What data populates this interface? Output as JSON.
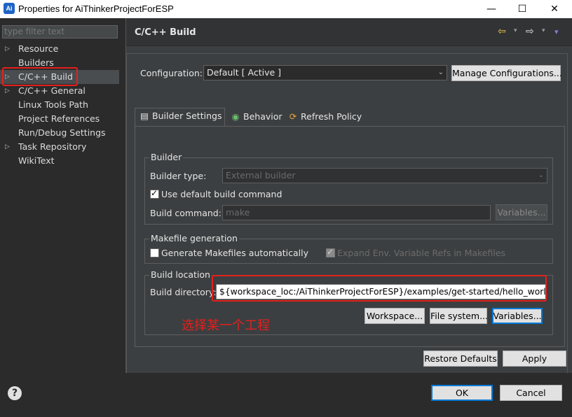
{
  "window": {
    "title": "Properties for AiThinkerProjectForESP",
    "app_icon": "Ai",
    "minimize_glyph": "—",
    "maximize_glyph": "☐",
    "close_glyph": "✕"
  },
  "sidebar": {
    "filter_placeholder": "type filter text",
    "items": [
      {
        "label": "Resource",
        "expandable": true
      },
      {
        "label": "Builders",
        "expandable": false
      },
      {
        "label": "C/C++ Build",
        "expandable": true,
        "selected": true
      },
      {
        "label": "C/C++ General",
        "expandable": true
      },
      {
        "label": "Linux Tools Path",
        "expandable": false
      },
      {
        "label": "Project References",
        "expandable": false
      },
      {
        "label": "Run/Debug Settings",
        "expandable": false
      },
      {
        "label": "Task Repository",
        "expandable": true
      },
      {
        "label": "WikiText",
        "expandable": false
      }
    ],
    "arrow_glyph": "▷"
  },
  "header": {
    "title": "C/C++ Build",
    "back_icon": "⇦",
    "forward_icon": "⇨",
    "menu_caret": "▾"
  },
  "configuration": {
    "label": "Configuration:",
    "value": "Default  [ Active ]",
    "manage_button": "Manage Configurations..."
  },
  "tabs": [
    {
      "label": "Builder Settings",
      "icon": "▤",
      "active": true
    },
    {
      "label": "Behavior",
      "icon": "◉",
      "active": false
    },
    {
      "label": "Refresh Policy",
      "icon": "⟳",
      "active": false
    }
  ],
  "builder_group": {
    "title": "Builder",
    "type_label": "Builder type:",
    "type_value": "External builder",
    "use_default_label": "Use default build command",
    "use_default_checked": true,
    "command_label": "Build command:",
    "command_value": "make",
    "variables_button": "Variables..."
  },
  "makefile_group": {
    "title": "Makefile generation",
    "generate_label": "Generate Makefiles automatically",
    "generate_checked": false,
    "expand_label": "Expand Env. Variable Refs in Makefiles",
    "expand_checked": true
  },
  "location_group": {
    "title": "Build location",
    "dir_label": "Build directory:",
    "dir_value": "${workspace_loc:/AiThinkerProjectForESP}/examples/get-started/hello_world",
    "workspace_button": "Workspace...",
    "filesystem_button": "File system...",
    "variables_button": "Variables..."
  },
  "annotation": {
    "text": "选择某一个工程",
    "color": "#e4201c"
  },
  "footer": {
    "restore_button": "Restore Defaults",
    "apply_button": "Apply",
    "ok_button": "OK",
    "cancel_button": "Cancel",
    "help_icon": "?"
  },
  "colors": {
    "background": "#3c3f41",
    "sidebar": "#2b2b2b",
    "accent_focus": "#0078d7",
    "icon_arrow": "#f0c650"
  }
}
